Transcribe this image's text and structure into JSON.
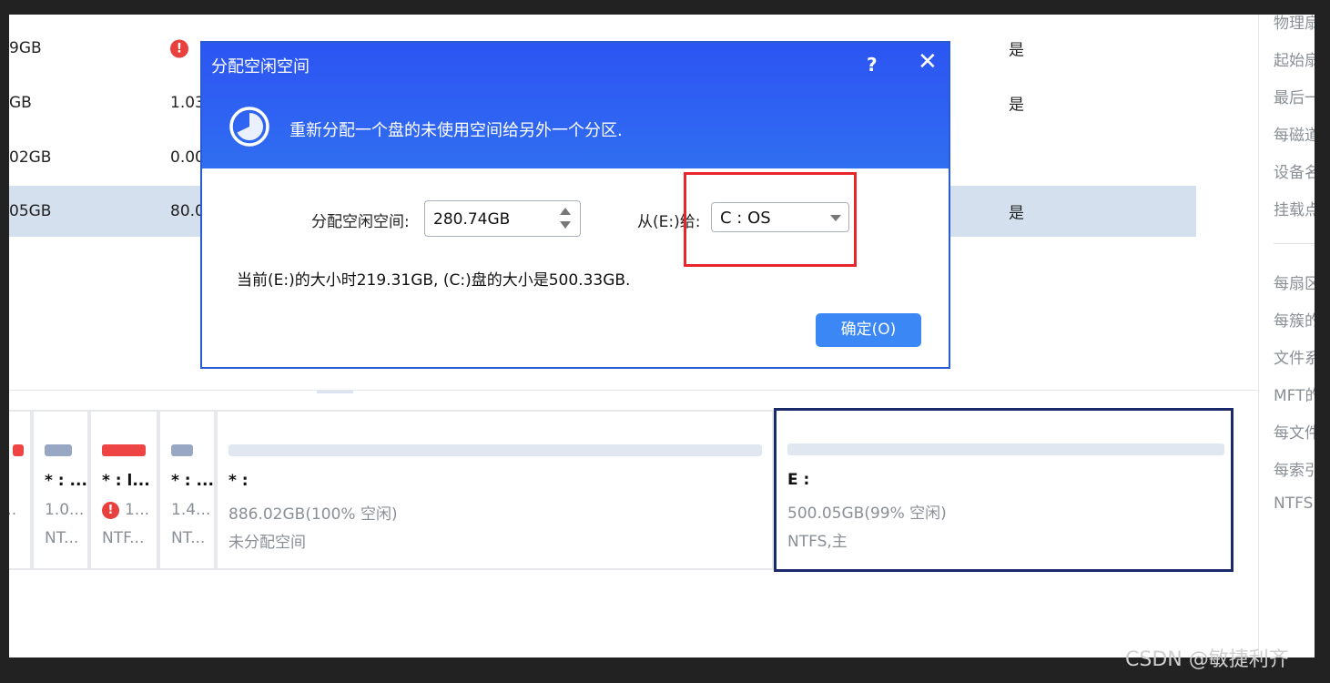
{
  "table": {
    "rows": [
      {
        "size": "9GB",
        "used": "",
        "used_warning": true,
        "flag": "是"
      },
      {
        "size": "GB",
        "used": "1.03",
        "used_warning": false,
        "flag": "是"
      },
      {
        "size": "02GB",
        "used": "0.00",
        "used_warning": false,
        "flag": ""
      },
      {
        "size": "05GB",
        "used": "80.0",
        "used_warning": false,
        "flag": "是",
        "selected": true
      }
    ]
  },
  "sidebar": {
    "items": [
      "物理扇",
      "起始扇",
      "最后一",
      "每磁道",
      "设备名",
      "挂载点",
      "每扇区",
      "每簇的",
      "文件系",
      "MFT的",
      "每文件",
      "每索引",
      "NTFS"
    ]
  },
  "disk_map": {
    "partitions": [
      {
        "name": "",
        "line1": "...",
        "line2": "",
        "bar_color": "red",
        "warning": false
      },
      {
        "name": "* : ...",
        "line1": "1.0...",
        "line2": "NT...",
        "bar_color": "gray",
        "warning": false
      },
      {
        "name": "* : l...",
        "line1": "1...",
        "line2": "NTF...",
        "bar_color": "red",
        "warning": true
      },
      {
        "name": "* : ...",
        "line1": "1.4...",
        "line2": "NT...",
        "bar_color": "gray",
        "warning": false
      },
      {
        "name": "* :",
        "line1": "886.02GB(100% 空闲)",
        "line2": "未分配空间",
        "bar_color": "light",
        "warning": false
      },
      {
        "name": "E :",
        "line1": "500.05GB(99% 空闲)",
        "line2": "NTFS,主",
        "bar_color": "light",
        "warning": false,
        "selected": true
      }
    ]
  },
  "dialog": {
    "title": "分配空闲空间",
    "help_icon": "?",
    "close_icon": "✕",
    "description": "重新分配一个盘的未使用空间给另外一个分区.",
    "alloc_label": "分配空闲空间:",
    "alloc_value": "280.74GB",
    "from_label": "从(E:)给:",
    "target_value": "C : OS",
    "info": "当前(E:)的大小时219.31GB, (C:)盘的大小是500.33GB.",
    "ok_label": "确定(O)",
    "accent_color": "#2f5ff2",
    "highlight_color": "#e8252a"
  },
  "watermark": "CSDN @敏捷利齐"
}
